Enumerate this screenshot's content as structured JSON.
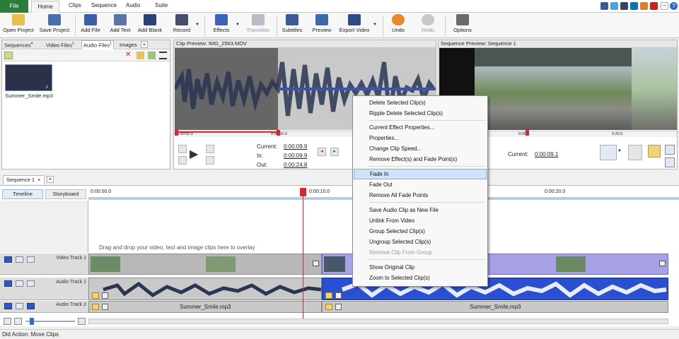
{
  "menubar": {
    "items": [
      "File",
      "Home",
      "Clips",
      "Sequence",
      "Audio",
      "Suite"
    ],
    "social_icons": [
      "facebook-icon",
      "twitter-icon",
      "tumblr-icon",
      "linkedin-icon",
      "email-icon",
      "youtube-icon",
      "minimize-icon",
      "help-icon"
    ]
  },
  "ribbon": {
    "buttons": {
      "open_project": "Open Project",
      "save_project": "Save Project",
      "add_file": "Add File",
      "add_text": "Add Text",
      "add_blank": "Add Blank",
      "record": "Record",
      "effects": "Effects",
      "transition": "Transition",
      "subtitles": "Subtitles",
      "preview": "Preview",
      "export_video": "Export Video",
      "undo": "Undo",
      "redo": "Redo",
      "options": "Options"
    }
  },
  "media_bin": {
    "tabs": [
      "Sequences",
      "Video Files",
      "Audio Files",
      "Images",
      "+"
    ],
    "tab_counts": [
      "4",
      "1",
      "1"
    ],
    "file_name": "Summer_Smile.mp3"
  },
  "clip_preview": {
    "title": "Clip Preview: IMG_2563.MOV",
    "ruler": [
      "0:00:00.0",
      "0:00:10.0"
    ],
    "current_label": "Current:",
    "current_value": "0:00:09.9",
    "in_label": "In:",
    "in_value": "0:00:09.9",
    "out_label": "Out:",
    "out_value": "0:00:24.8"
  },
  "sequence_preview": {
    "title": "Sequence Preview: Sequence 1",
    "ruler": [
      "0:00",
      "0:20.0"
    ],
    "current_label": "Current:",
    "current_value": "0:00:09.1"
  },
  "sequence_tab": "Sequence 1",
  "timeline": {
    "view_tabs": [
      "Timeline",
      "Storyboard"
    ],
    "ruler": [
      "0:00:00.0",
      "0:00:10.0",
      "0:00:20.0"
    ],
    "overlay_hint": "Drag and drop your video, text and image clips here to overlay",
    "tracks": [
      "Video Track 1",
      "Audio Track 1",
      "Audio Track 2"
    ],
    "audio_clip_left": "Summer_Smile.mp3",
    "audio_clip_right": "Summer_Smile.mp3"
  },
  "context_menu": {
    "items": [
      "Delete Selected Clip(s)",
      "Ripple Delete Selected Clip(s)",
      "Current Effect Properties...",
      "Properties...",
      "Change Clip Speed...",
      "Remove Effect(s) and Fade Point(s)",
      "Fade In",
      "Fade Out",
      "Remove All Fade Points",
      "Save Audio Clip as New File",
      "Unlink From Video",
      "Group Selected Clip(s)",
      "Ungroup Selected Clip(s)",
      "Remove Clip From Group",
      "Show Original Clip",
      "Zoom to Selected Clip(s)"
    ],
    "highlighted": "Fade In",
    "disabled": [
      "Remove Clip From Group"
    ]
  },
  "status": "Did Action: Move Clips",
  "colors": {
    "file_tab": "#2d7d3a",
    "playhead": "#d9262c",
    "selected_clip": "#2b4fd1",
    "waveform": "#2a3552"
  }
}
